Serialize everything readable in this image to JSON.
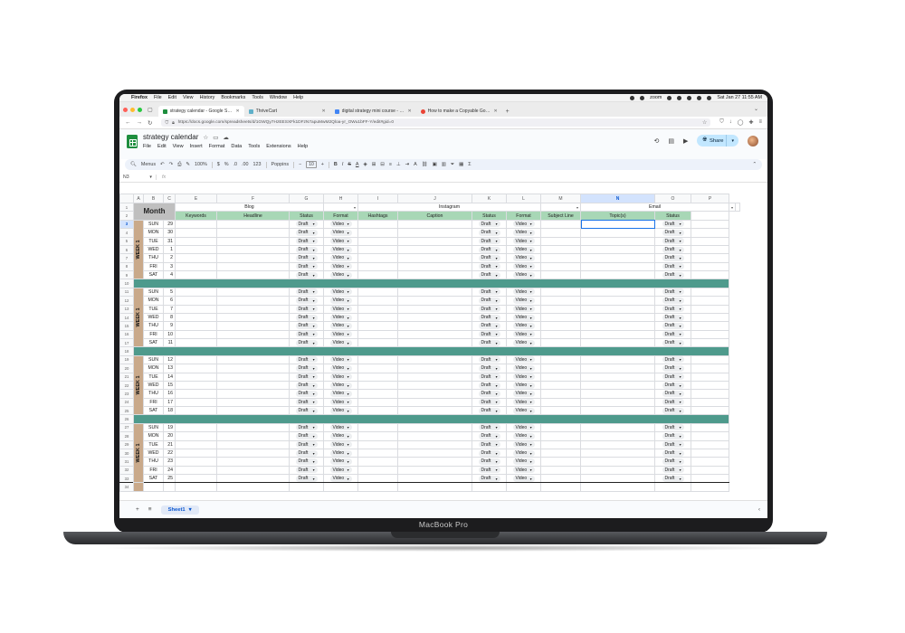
{
  "menubar": {
    "app": "Firefox",
    "items": [
      "File",
      "Edit",
      "View",
      "History",
      "Bookmarks",
      "Tools",
      "Window",
      "Help"
    ],
    "zoom": "zoom",
    "datetime": "Sat Jan 27  11:55 AM"
  },
  "browser": {
    "tabs": [
      {
        "title": "strategy calendar - Google Sheets",
        "color": "#1e8e3e"
      },
      {
        "title": "ThriveCart",
        "color": "#5fb0c9"
      },
      {
        "title": "digital strategy mini course - Google",
        "color": "#4285f4"
      },
      {
        "title": "How to make a Copyable Google",
        "color": "#ea4335"
      }
    ],
    "url": "https://docs.google.com/spreadsheets/d/1GWQy7HzEESXFk1DFzN7apuMwM2Qloa-yr_OWu1bFF-Y/edit#gid=0"
  },
  "sheets": {
    "title": "strategy calendar",
    "menus": [
      "File",
      "Edit",
      "View",
      "Insert",
      "Format",
      "Data",
      "Tools",
      "Extensions",
      "Help"
    ],
    "share_label": "Share",
    "toolbar": {
      "search": "Menus",
      "zoom": "100%",
      "currency": "$",
      "percent": "%",
      "dec_less": ".0",
      "dec_more": ".00",
      "number_format": "123",
      "font": "Poppins",
      "font_size": "10"
    },
    "name_box": "N3",
    "fx": "fx"
  },
  "grid": {
    "columns": [
      "A",
      "B",
      "C",
      "E",
      "F",
      "G",
      "H",
      "I",
      "J",
      "K",
      "L",
      "M",
      "N",
      "O",
      "P"
    ],
    "selected_column": "N",
    "sections": {
      "blog": "Blog",
      "instagram": "Instagram",
      "email": "Email"
    },
    "month_label": "Month",
    "headers": {
      "keywords": "Keywords",
      "headline": "Headline",
      "status": "Status",
      "format": "Format",
      "hashtags": "Hashtags",
      "caption": "Caption",
      "subject_line": "Subject Line",
      "topics": "Topic(s)"
    },
    "chip_status": "Draft",
    "chip_format": "Video",
    "weeks": [
      {
        "label": "WEEK 1",
        "days": [
          [
            "SUN",
            "29"
          ],
          [
            "MON",
            "30"
          ],
          [
            "TUE",
            "31"
          ],
          [
            "WED",
            "1"
          ],
          [
            "THU",
            "2"
          ],
          [
            "FRI",
            "3"
          ],
          [
            "SAT",
            "4"
          ]
        ]
      },
      {
        "label": "WEEK 1",
        "days": [
          [
            "SUN",
            "5"
          ],
          [
            "MON",
            "6"
          ],
          [
            "TUE",
            "7"
          ],
          [
            "WED",
            "8"
          ],
          [
            "THU",
            "9"
          ],
          [
            "FRI",
            "10"
          ],
          [
            "SAT",
            "11"
          ]
        ]
      },
      {
        "label": "WEEK 1",
        "days": [
          [
            "SUN",
            "12"
          ],
          [
            "MON",
            "13"
          ],
          [
            "TUE",
            "14"
          ],
          [
            "WED",
            "15"
          ],
          [
            "THU",
            "16"
          ],
          [
            "FRI",
            "17"
          ],
          [
            "SAT",
            "18"
          ]
        ]
      },
      {
        "label": "WEEK 1",
        "days": [
          [
            "SUN",
            "19"
          ],
          [
            "MON",
            "20"
          ],
          [
            "TUE",
            "21"
          ],
          [
            "WED",
            "22"
          ],
          [
            "THU",
            "23"
          ],
          [
            "FRI",
            "24"
          ],
          [
            "SAT",
            "25"
          ]
        ]
      }
    ],
    "last_row": "34"
  },
  "sheet_tabs": {
    "active": "Sheet1"
  },
  "laptop_label": "MacBook Pro",
  "colors": {
    "divider": "#4e9a8c",
    "subheader": "#a8d7b6",
    "week_band": "#c9a98a",
    "month_cell": "#bfbfbf"
  }
}
